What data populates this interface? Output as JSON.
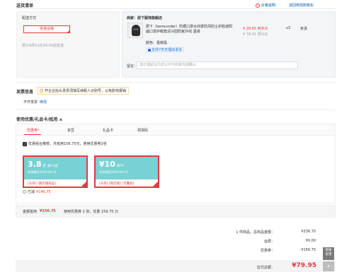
{
  "header": {
    "title": "送货清单",
    "price_note": "价格说明",
    "back_cart": "返回修改购物车"
  },
  "delivery": {
    "label": "配送方式",
    "method_btn": "快递运输",
    "eta": "预计4月12日24:00前发货"
  },
  "merchant": {
    "label": "商家：居下服饰旗舰店"
  },
  "product": {
    "name": "居下（beneunder）防晒口罩女四季防风防尘护脸遮阳面口罩护眼角清冷团防紫外线 墨镜",
    "price": "¥ 26.65 到手价",
    "orig_price": "¥ 78.91 原价价",
    "qty": "x3",
    "stock": "有货",
    "color_label": "颜色：墨镜黑",
    "service": "支持7天无理由退货"
  },
  "remark": {
    "label": "留言：",
    "placeholder": "选价填留言内容以可与商家沟通确认"
  },
  "invoice": {
    "title": "发票信息",
    "tip": "开企业抬头发票须填写纳税人识别号，以免影响报销",
    "value": "不开发票",
    "edit": "修改"
  },
  "coupons": {
    "title": "使用优惠/礼品卡/抵用 ∧",
    "tabs": [
      "优惠券",
      "京豆",
      "礼品卡",
      "领货码"
    ],
    "combo_check": "优惠组合推荐，共抵用156.75元，使用优惠券2张",
    "items": [
      {
        "amount": "3.8",
        "unit": "折",
        "cond": "满20减",
        "date": "有效期至2023-04-11",
        "scope": "[东券] [限店铺商品]"
      },
      {
        "amount": "¥10",
        "unit": "",
        "cond": "满79",
        "date": "有效期至2023-04-11",
        "scope": "[东券] [限店铺] [可叠加]"
      }
    ],
    "used": "已减",
    "used_amount": "¥146.75"
  },
  "summary_bar": {
    "label": "金额抵用",
    "amount": "¥156.75",
    "text": "使用优惠券 2 张，优惠 156.75 元"
  },
  "totals": {
    "goods_label": "1 件商品，总商品金额：",
    "goods": "¥236.70",
    "ship_label": "运费：",
    "ship": "¥0.00",
    "disc_label": "优惠券：",
    "disc": "-¥156.75",
    "pay_label": "应付总额：",
    "pay": "¥79.95"
  },
  "side": {
    "feedback": "我要\n反馈",
    "top": "∧"
  }
}
